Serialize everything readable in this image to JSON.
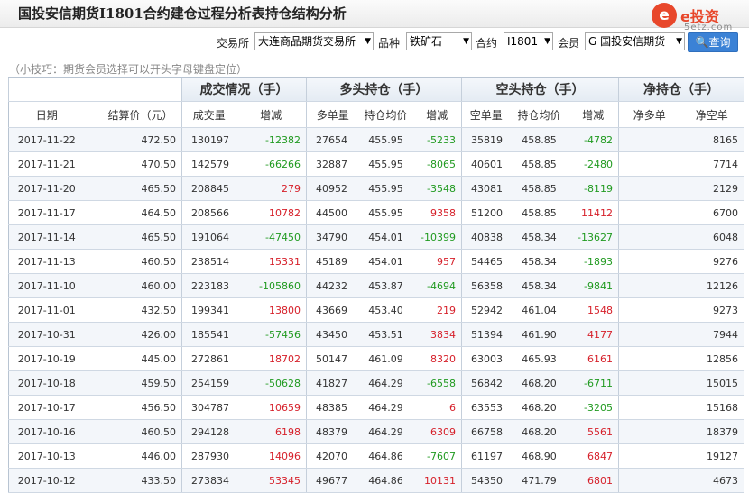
{
  "title": "国投安信期货I1801合约建仓过程分析表持仓结构分析",
  "logo": {
    "mark": "e",
    "brand": "e投资",
    "site": "5etz.com"
  },
  "filters": {
    "exchange_label": "交易所",
    "exchange_value": "大连商品期货交易所",
    "variety_label": "品种",
    "variety_value": "铁矿石",
    "contract_label": "合约",
    "contract_value": "I1801",
    "member_label": "会员",
    "member_value": "G 国投安信期货",
    "query_label": "查询"
  },
  "tip": "（小技巧：期货会员选择可以开头字母键盘定位）",
  "groups": [
    "成交情况（手）",
    "多头持仓（手）",
    "空头持仓（手）",
    "净持仓（手）"
  ],
  "columns": [
    "日期",
    "结算价（元）",
    "成交量",
    "增减",
    "多单量",
    "持仓均价",
    "增减",
    "空单量",
    "持仓均价",
    "增减",
    "净多单",
    "净空单"
  ],
  "rows": [
    [
      "2017-11-22",
      "472.50",
      "130197",
      "-12382",
      "27654",
      "455.95",
      "-5233",
      "35819",
      "458.85",
      "-4782",
      "",
      "8165"
    ],
    [
      "2017-11-21",
      "470.50",
      "142579",
      "-66266",
      "32887",
      "455.95",
      "-8065",
      "40601",
      "458.85",
      "-2480",
      "",
      "7714"
    ],
    [
      "2017-11-20",
      "465.50",
      "208845",
      "279",
      "40952",
      "455.95",
      "-3548",
      "43081",
      "458.85",
      "-8119",
      "",
      "2129"
    ],
    [
      "2017-11-17",
      "464.50",
      "208566",
      "10782",
      "44500",
      "455.95",
      "9358",
      "51200",
      "458.85",
      "11412",
      "",
      "6700"
    ],
    [
      "2017-11-14",
      "465.50",
      "191064",
      "-47450",
      "34790",
      "454.01",
      "-10399",
      "40838",
      "458.34",
      "-13627",
      "",
      "6048"
    ],
    [
      "2017-11-13",
      "460.50",
      "238514",
      "15331",
      "45189",
      "454.01",
      "957",
      "54465",
      "458.34",
      "-1893",
      "",
      "9276"
    ],
    [
      "2017-11-10",
      "460.00",
      "223183",
      "-105860",
      "44232",
      "453.87",
      "-4694",
      "56358",
      "458.34",
      "-9841",
      "",
      "12126"
    ],
    [
      "2017-11-01",
      "432.50",
      "199341",
      "13800",
      "43669",
      "453.40",
      "219",
      "52942",
      "461.04",
      "1548",
      "",
      "9273"
    ],
    [
      "2017-10-31",
      "426.00",
      "185541",
      "-57456",
      "43450",
      "453.51",
      "3834",
      "51394",
      "461.90",
      "4177",
      "",
      "7944"
    ],
    [
      "2017-10-19",
      "445.00",
      "272861",
      "18702",
      "50147",
      "461.09",
      "8320",
      "63003",
      "465.93",
      "6161",
      "",
      "12856"
    ],
    [
      "2017-10-18",
      "459.50",
      "254159",
      "-50628",
      "41827",
      "464.29",
      "-6558",
      "56842",
      "468.20",
      "-6711",
      "",
      "15015"
    ],
    [
      "2017-10-17",
      "456.50",
      "304787",
      "10659",
      "48385",
      "464.29",
      "6",
      "63553",
      "468.20",
      "-3205",
      "",
      "15168"
    ],
    [
      "2017-10-16",
      "460.50",
      "294128",
      "6198",
      "48379",
      "464.29",
      "6309",
      "66758",
      "468.20",
      "5561",
      "",
      "18379"
    ],
    [
      "2017-10-13",
      "446.00",
      "287930",
      "14096",
      "42070",
      "464.86",
      "-7607",
      "61197",
      "468.90",
      "6847",
      "",
      "19127"
    ],
    [
      "2017-10-12",
      "433.50",
      "273834",
      "53345",
      "49677",
      "464.86",
      "10131",
      "54350",
      "471.79",
      "6801",
      "",
      "4673"
    ]
  ],
  "colors": {
    "up": "#d6202a",
    "down": "#209a20",
    "button": "#3b82d6",
    "brand": "#e8472b"
  }
}
